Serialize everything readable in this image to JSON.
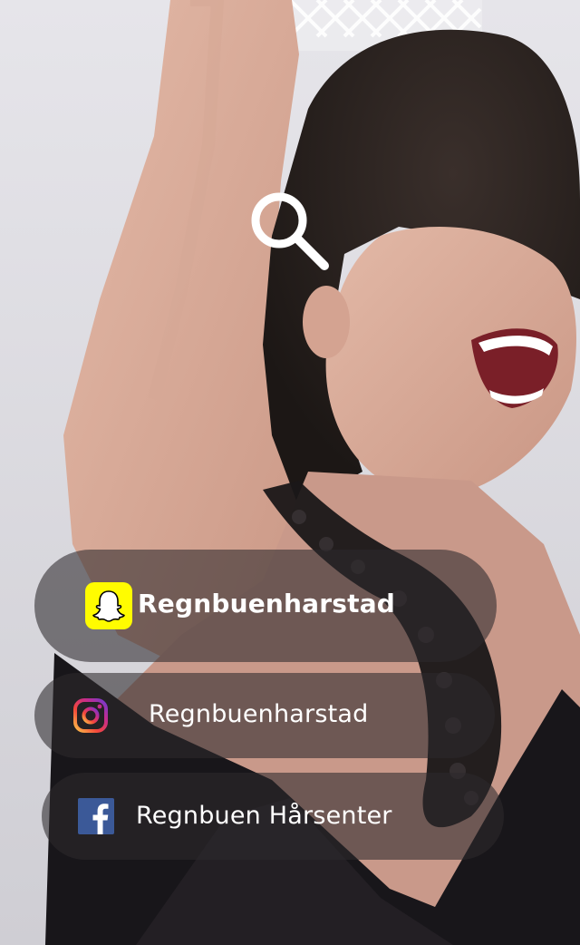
{
  "social_links": [
    {
      "platform": "snapchat",
      "icon": "snapchat-icon",
      "label": "Regnbuenharstad",
      "brand_color": "#fffc00"
    },
    {
      "platform": "instagram",
      "icon": "instagram-icon",
      "label": "Regnbuenharstad"
    },
    {
      "platform": "facebook",
      "icon": "facebook-icon",
      "label": "Regnbuen Hårsenter",
      "brand_color": "#3b5998"
    }
  ],
  "search": {
    "icon": "search-icon"
  },
  "colors": {
    "pill_background": "rgba(45,42,44,0.58)",
    "text": "#ffffff"
  }
}
